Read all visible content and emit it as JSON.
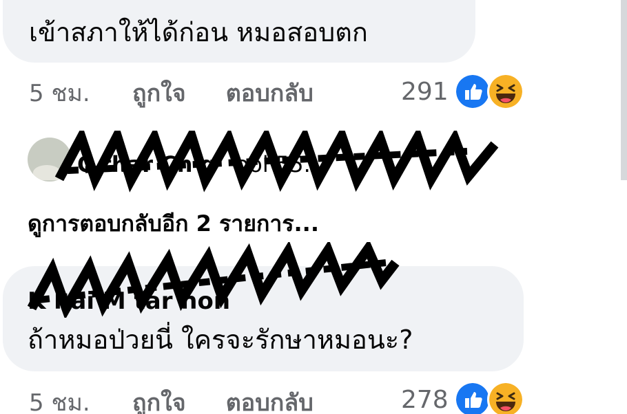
{
  "comments": [
    {
      "text": "เข้าสภาให้ได้ก่อน หมอสอบตก",
      "time": "5 ชม.",
      "like_label": "ถูกใจ",
      "reply_label": "ตอบกลับ",
      "reaction_count": "291",
      "reactions": [
        "like-reaction-icon",
        "haha-reaction-icon"
      ]
    },
    {
      "author": "K    hai M   tar    hon",
      "text": "ถ้าหมอป่วยนี่ ใครจะรักษาหมอนะ?",
      "time": "5 ชม.",
      "like_label": "ถูกใจ",
      "reply_label": "ตอบกลับ",
      "reaction_count": "278",
      "reactions": [
        "like-reaction-icon",
        "haha-reaction-icon"
      ]
    }
  ],
  "reply_preview": {
    "author": "C   thar   Ch      g",
    "text": "ool 55..."
  },
  "view_more_replies": "ดูการตอบกลับอีก 2 รายการ...",
  "colors": {
    "bubble": "#f0f2f5",
    "secondary_text": "#65676b",
    "like_blue": "#1877f2",
    "haha_yellow": "#f7b125"
  }
}
